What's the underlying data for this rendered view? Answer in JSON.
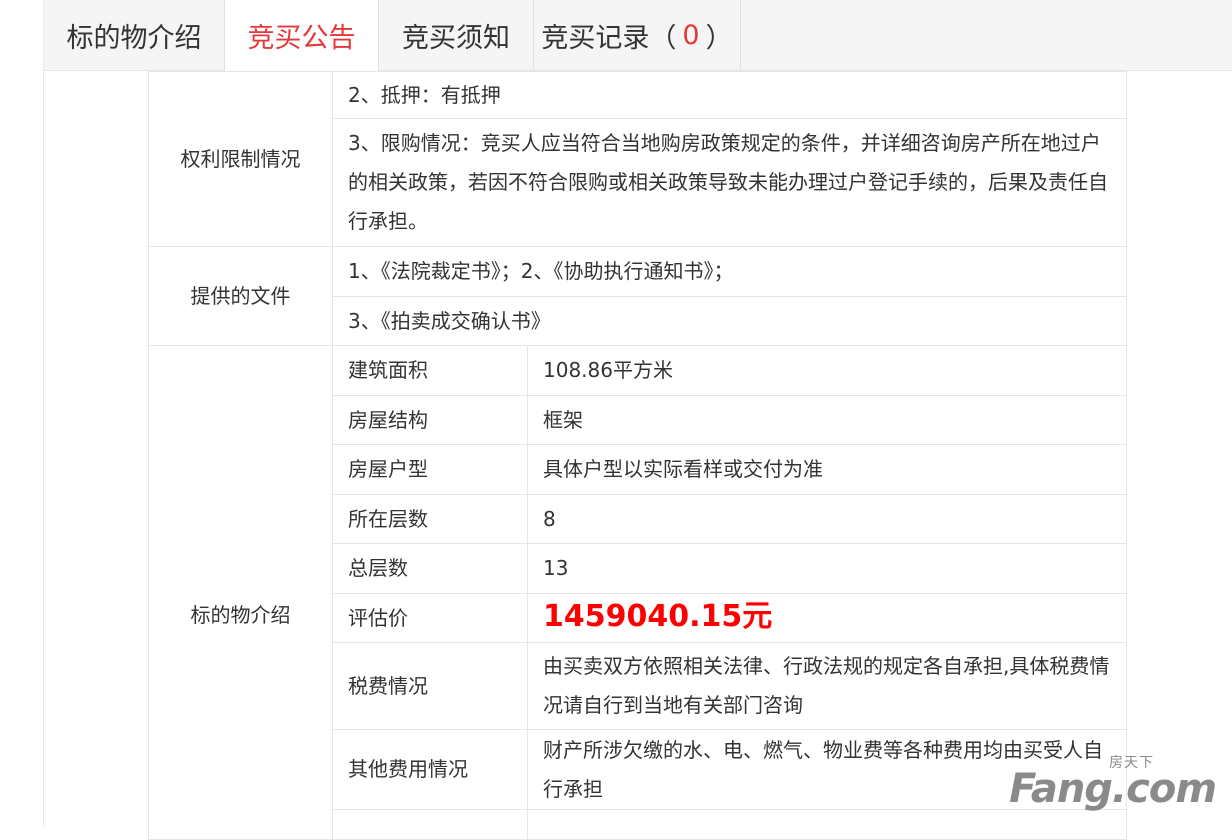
{
  "tabs": [
    {
      "label": "标的物介绍",
      "active": false
    },
    {
      "label": "竞买公告",
      "active": true
    },
    {
      "label": "竞买须知",
      "active": false
    },
    {
      "label": "竞买记录（",
      "count": "0",
      "suffix": "）",
      "active": false
    }
  ],
  "rights": {
    "label": "权利限制情况",
    "mortgage": "2、抵押：有抵押",
    "restriction": "3、限购情况：竞买人应当符合当地购房政策规定的条件，并详细咨询房产所在地过户的相关政策，若因不符合限购或相关政策导致未能办理过户登记手续的，后果及责任自行承担。"
  },
  "documents": {
    "label": "提供的文件",
    "line1": "1、《法院裁定书》；2、《协助执行通知书》；",
    "line2": "3、《拍卖成交确认书》"
  },
  "subject": {
    "label": "标的物介绍",
    "rows": [
      {
        "key": "建筑面积",
        "value": "108.86平方米"
      },
      {
        "key": "房屋结构",
        "value": "框架"
      },
      {
        "key": "房屋户型",
        "value": "具体户型以实际看样或交付为准"
      },
      {
        "key": "所在层数",
        "value": "8"
      },
      {
        "key": "总层数",
        "value": "13"
      },
      {
        "key": "评估价",
        "value": "1459040.15元"
      },
      {
        "key": "税费情况",
        "value": "由买卖双方依照相关法律、行政法规的规定各自承担,具体税费情况请自行到当地有关部门咨询"
      },
      {
        "key": "其他费用情况",
        "value": "财产所涉欠缴的水、电、燃气、物业费等各种费用均由买受人自行承担"
      }
    ]
  },
  "watermark": {
    "top": "房天下",
    "main": "Fang.com"
  }
}
